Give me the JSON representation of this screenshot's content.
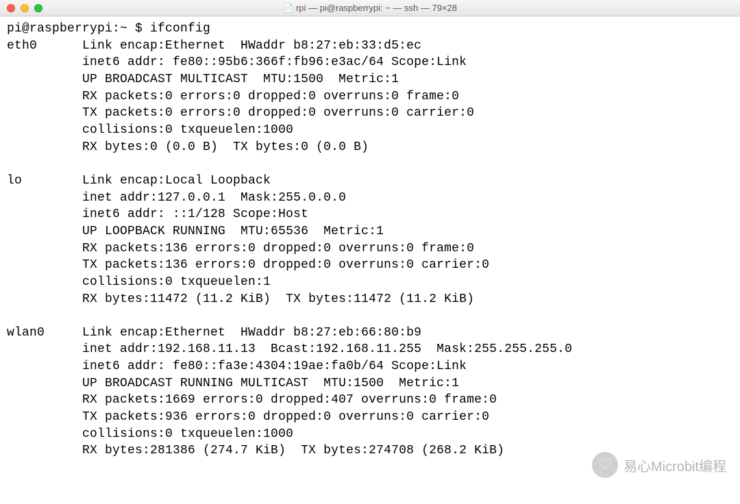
{
  "window": {
    "title": "rpi — pi@raspberrypi: ~ — ssh — 79×28",
    "file_icon": "📄"
  },
  "prompt": {
    "user_host": "pi@raspberrypi",
    "sep": ":",
    "path": "~",
    "symbol": "$",
    "command": "ifconfig"
  },
  "ifconfig": {
    "eth0": {
      "name": "eth0",
      "lines": [
        "Link encap:Ethernet  HWaddr b8:27:eb:33:d5:ec",
        "inet6 addr: fe80::95b6:366f:fb96:e3ac/64 Scope:Link",
        "UP BROADCAST MULTICAST  MTU:1500  Metric:1",
        "RX packets:0 errors:0 dropped:0 overruns:0 frame:0",
        "TX packets:0 errors:0 dropped:0 overruns:0 carrier:0",
        "collisions:0 txqueuelen:1000",
        "RX bytes:0 (0.0 B)  TX bytes:0 (0.0 B)"
      ]
    },
    "lo": {
      "name": "lo",
      "lines": [
        "Link encap:Local Loopback",
        "inet addr:127.0.0.1  Mask:255.0.0.0",
        "inet6 addr: ::1/128 Scope:Host",
        "UP LOOPBACK RUNNING  MTU:65536  Metric:1",
        "RX packets:136 errors:0 dropped:0 overruns:0 frame:0",
        "TX packets:136 errors:0 dropped:0 overruns:0 carrier:0",
        "collisions:0 txqueuelen:1",
        "RX bytes:11472 (11.2 KiB)  TX bytes:11472 (11.2 KiB)"
      ]
    },
    "wlan0": {
      "name": "wlan0",
      "lines": [
        "Link encap:Ethernet  HWaddr b8:27:eb:66:80:b9",
        "inet addr:192.168.11.13  Bcast:192.168.11.255  Mask:255.255.255.0",
        "inet6 addr: fe80::fa3e:4304:19ae:fa0b/64 Scope:Link",
        "UP BROADCAST RUNNING MULTICAST  MTU:1500  Metric:1",
        "RX packets:1669 errors:0 dropped:407 overruns:0 frame:0",
        "TX packets:936 errors:0 dropped:0 overruns:0 carrier:0",
        "collisions:0 txqueuelen:1000",
        "RX bytes:281386 (274.7 KiB)  TX bytes:274708 (268.2 KiB)"
      ]
    }
  },
  "watermark": {
    "text": "易心Microbit编程",
    "icon_glyph": "♡"
  },
  "layout": {
    "indent": "          "
  }
}
